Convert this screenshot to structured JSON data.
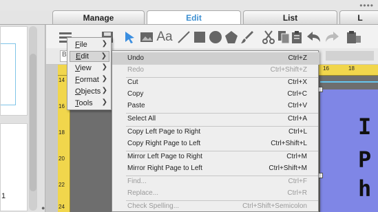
{
  "window": {
    "dots": "••••"
  },
  "tabs": [
    {
      "label": "Manage",
      "active": false
    },
    {
      "label": "Edit",
      "active": true
    },
    {
      "label": "List",
      "active": false
    },
    {
      "label": "L",
      "active": false
    }
  ],
  "left_panel": {
    "page_number": "1"
  },
  "toolbar": {
    "icons": [
      "hamburger-icon",
      "save-icon",
      "pointer-icon",
      "picture-icon",
      "text-icon",
      "line-icon",
      "rectangle-icon",
      "circle-icon",
      "pentagon-icon",
      "brush-icon",
      "cut-icon",
      "copy-icon",
      "paste-icon",
      "undo-icon",
      "redo-icon",
      "paste-special-icon"
    ],
    "font_field": "Ba"
  },
  "ruler": {
    "h_numbers": [
      "16",
      "18"
    ],
    "v_numbers": [
      "14",
      "16",
      "18",
      "20",
      "22",
      "24"
    ]
  },
  "canvas": {
    "text_lines": [
      "I",
      "P",
      "h"
    ]
  },
  "main_menu": {
    "items": [
      {
        "label": "File",
        "selected": false
      },
      {
        "label": "Edit",
        "selected": true
      },
      {
        "label": "View",
        "selected": false
      },
      {
        "label": "Format",
        "selected": false
      },
      {
        "label": "Objects",
        "selected": false
      },
      {
        "label": "Tools",
        "selected": false
      }
    ]
  },
  "edit_menu": {
    "items": [
      {
        "label": "Undo",
        "shortcut": "Ctrl+Z",
        "enabled": true,
        "highlighted": true
      },
      {
        "label": "Redo",
        "shortcut": "Ctrl+Shift+Z",
        "enabled": false,
        "highlighted": false
      },
      {
        "label": "Cut",
        "shortcut": "Ctrl+X",
        "enabled": true,
        "highlighted": false
      },
      {
        "label": "Copy",
        "shortcut": "Ctrl+C",
        "enabled": true,
        "highlighted": false
      },
      {
        "label": "Paste",
        "shortcut": "Ctrl+V",
        "enabled": true,
        "highlighted": false
      },
      {
        "label": "Select All",
        "shortcut": "Ctrl+A",
        "enabled": true,
        "highlighted": false
      },
      {
        "label": "Copy Left Page to Right",
        "shortcut": "Ctrl+L",
        "enabled": true,
        "highlighted": false
      },
      {
        "label": "Copy Right Page to Left",
        "shortcut": "Ctrl+Shift+L",
        "enabled": true,
        "highlighted": false
      },
      {
        "label": "Mirror Left Page to Right",
        "shortcut": "Ctrl+M",
        "enabled": true,
        "highlighted": false
      },
      {
        "label": "Mirror Right Page to Left",
        "shortcut": "Ctrl+Shift+M",
        "enabled": true,
        "highlighted": false
      },
      {
        "label": "Find...",
        "shortcut": "Ctrl+F",
        "enabled": false,
        "highlighted": false
      },
      {
        "label": "Replace...",
        "shortcut": "Ctrl+R",
        "enabled": false,
        "highlighted": false
      },
      {
        "label": "Check Spelling...",
        "shortcut": "Ctrl+Shift+Semicolon",
        "enabled": false,
        "highlighted": false
      }
    ]
  }
}
